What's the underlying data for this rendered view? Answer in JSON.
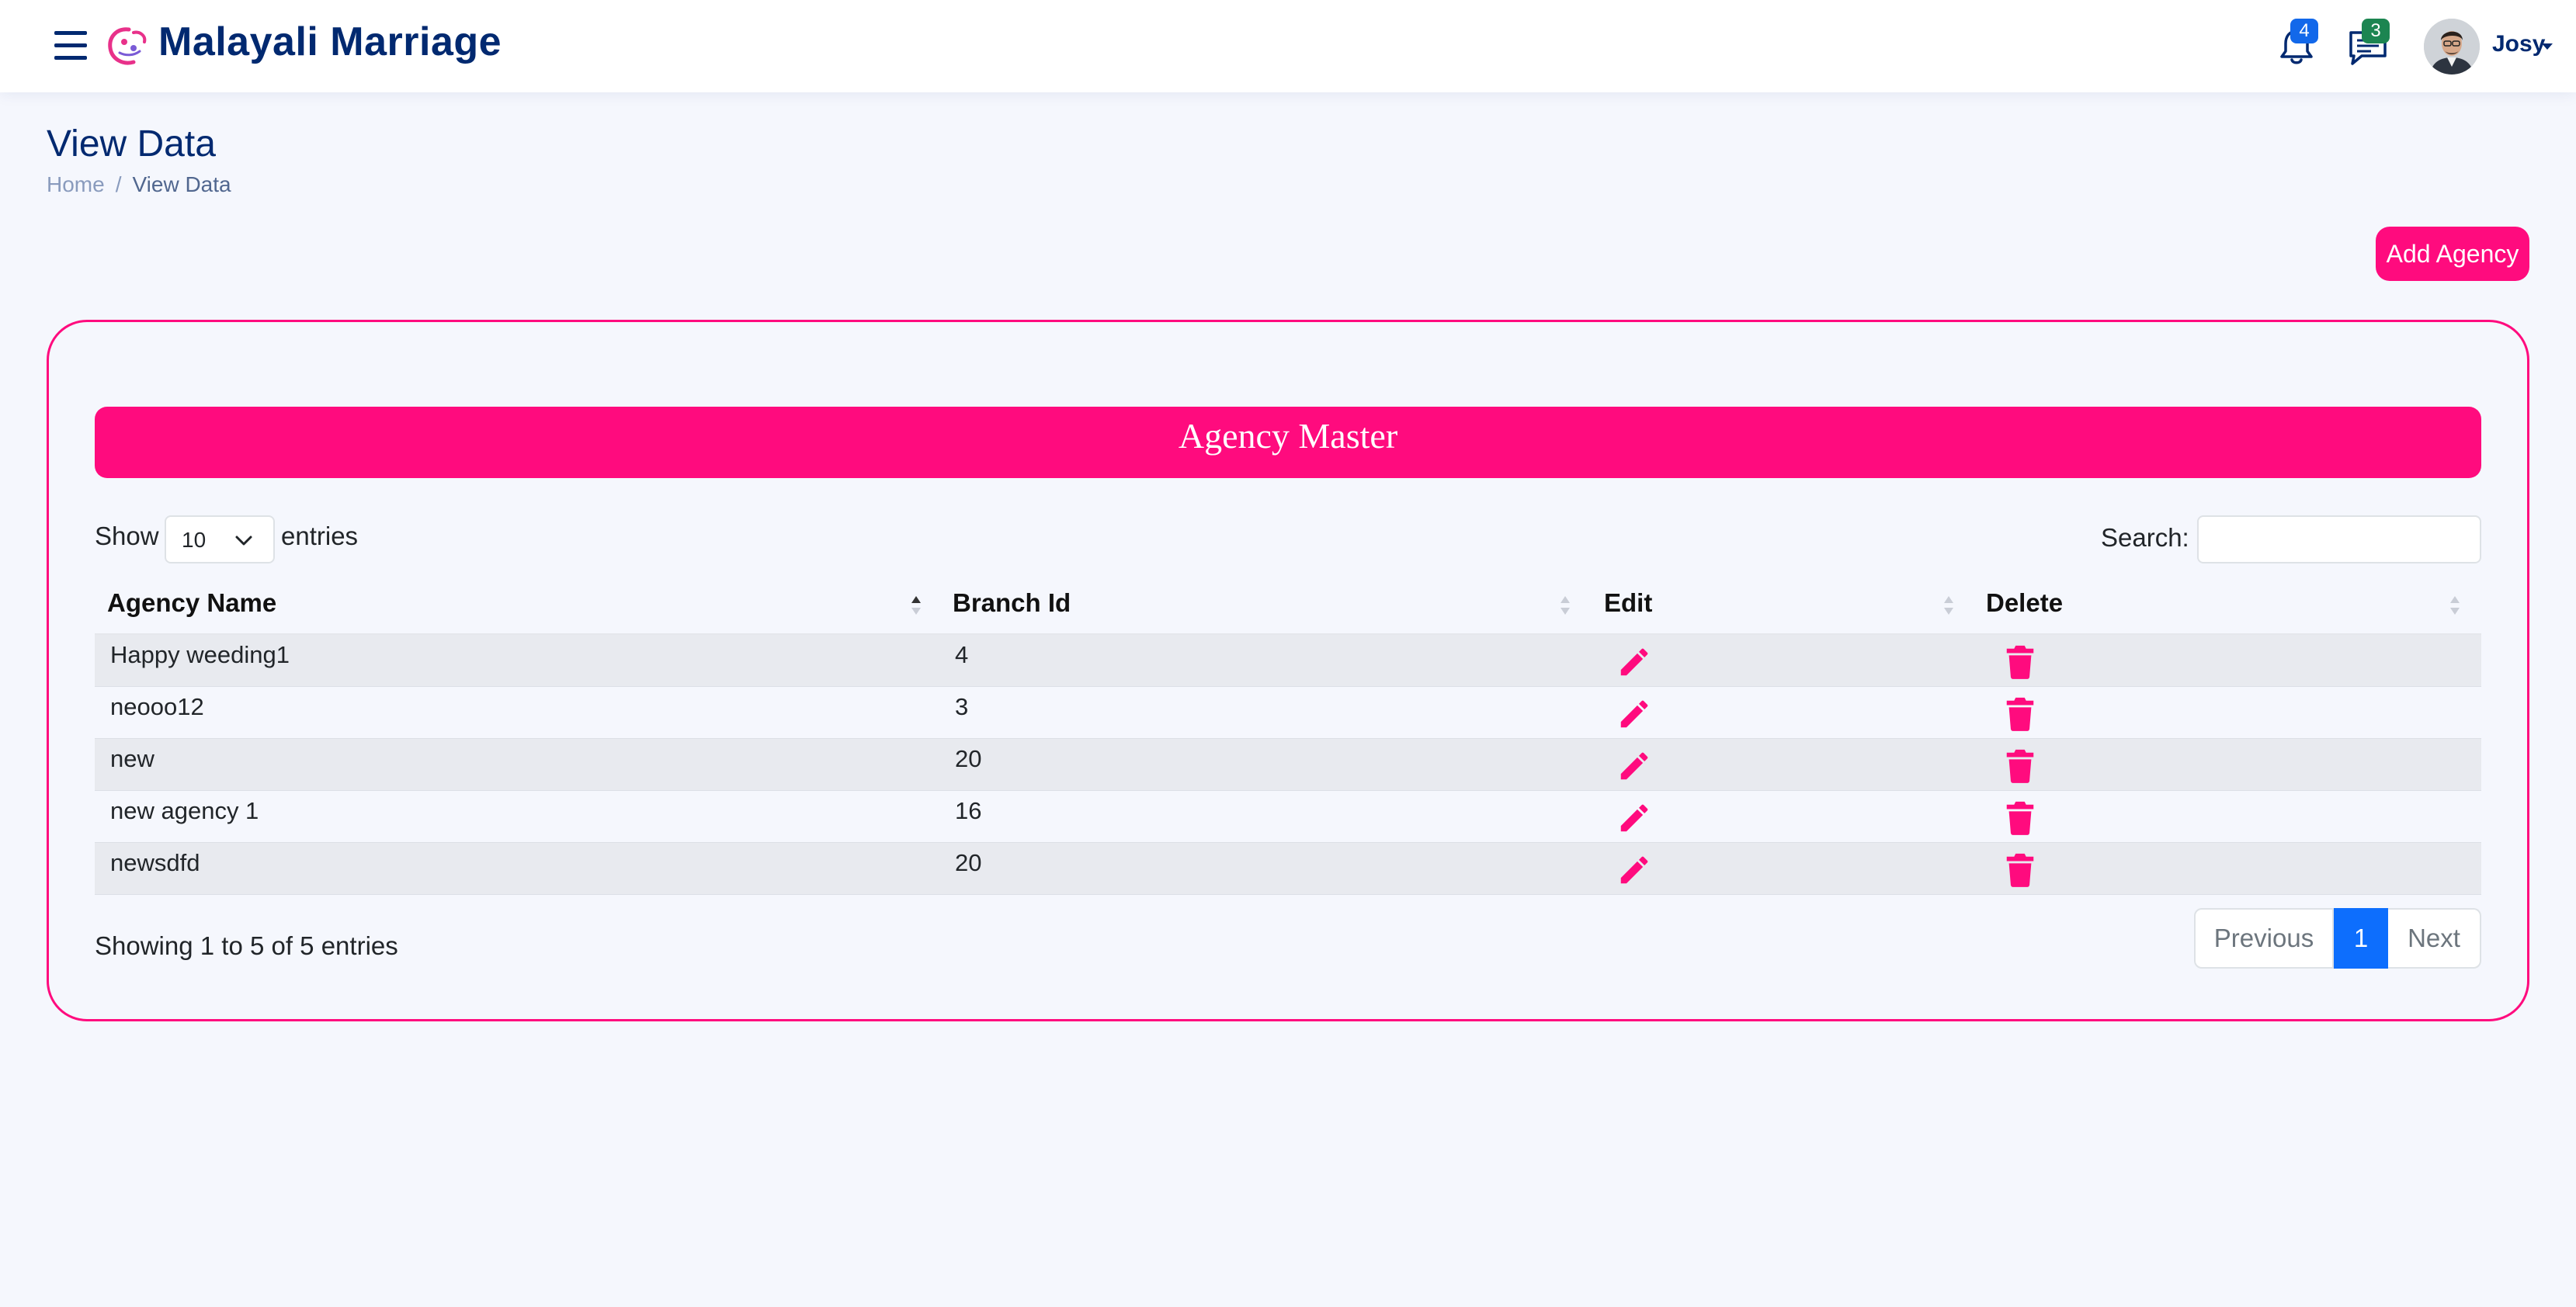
{
  "header": {
    "brand": "Malayali Marriage",
    "notifications_count": "4",
    "messages_count": "3",
    "user_name": "Josy"
  },
  "page": {
    "title": "View Data",
    "breadcrumb": [
      "Home",
      "View Data"
    ],
    "add_button": "Add Agency"
  },
  "card": {
    "heading": "Agency Master",
    "show_label": "Show",
    "page_length": "10",
    "entries_label": "entries",
    "search_label": "Search:",
    "search_value": ""
  },
  "table": {
    "columns": [
      "Agency Name",
      "Branch Id",
      "Edit",
      "Delete"
    ],
    "rows": [
      {
        "agency_name": "Happy weeding1",
        "branch_id": "4"
      },
      {
        "agency_name": "neooo12",
        "branch_id": "3"
      },
      {
        "agency_name": "new",
        "branch_id": "20"
      },
      {
        "agency_name": "new agency 1",
        "branch_id": "16"
      },
      {
        "agency_name": "newsdfd",
        "branch_id": "20"
      }
    ],
    "info": "Showing 1 to 5 of 5 entries"
  },
  "pagination": {
    "previous": "Previous",
    "current": "1",
    "next": "Next"
  },
  "colors": {
    "accent_pink": "#ff0b7e",
    "brand_navy": "#012970",
    "pager_active": "#0d6efd",
    "badge_blue": "#1268ea",
    "badge_green": "#1c8551"
  },
  "icons": [
    "menu-icon",
    "logo-icon",
    "bell-icon",
    "chat-icon",
    "chevron-down-icon",
    "sort-icon",
    "pencil-icon",
    "trash-icon"
  ]
}
